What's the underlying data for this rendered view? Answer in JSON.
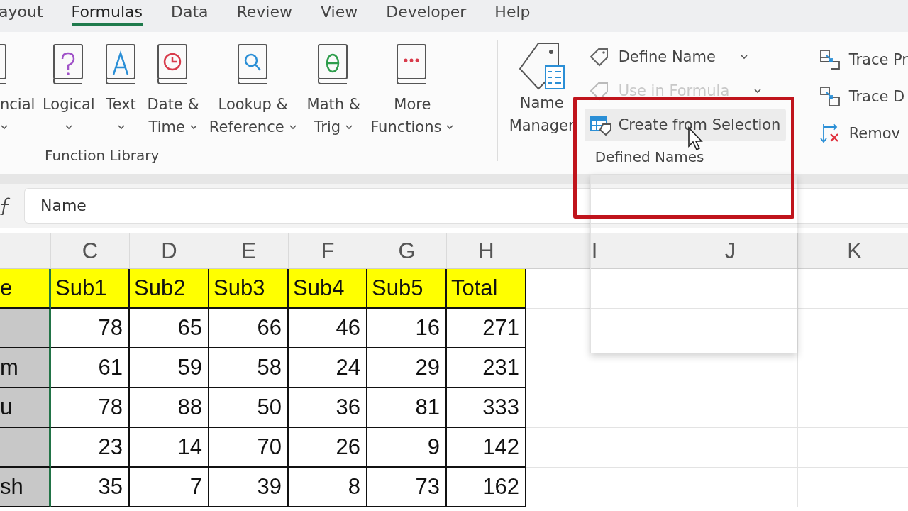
{
  "tabs": [
    {
      "label": "ayout",
      "selected": false
    },
    {
      "label": "Formulas",
      "selected": true
    },
    {
      "label": "Data",
      "selected": false
    },
    {
      "label": "Review",
      "selected": false
    },
    {
      "label": "View",
      "selected": false
    },
    {
      "label": "Developer",
      "selected": false
    },
    {
      "label": "Help",
      "selected": false
    }
  ],
  "function_library": {
    "label": "Function Library",
    "items": [
      {
        "kind": "financial",
        "lines": [
          "ncial"
        ],
        "dropdown": true
      },
      {
        "kind": "logical",
        "lines": [
          "Logical"
        ],
        "dropdown": true
      },
      {
        "kind": "text",
        "lines": [
          "Text"
        ],
        "dropdown": true
      },
      {
        "kind": "datetime",
        "lines": [
          "Date &",
          "Time"
        ],
        "dropdown": true
      },
      {
        "kind": "lookup",
        "lines": [
          "Lookup &",
          "Reference"
        ],
        "dropdown": true
      },
      {
        "kind": "math",
        "lines": [
          "Math &",
          "Trig"
        ],
        "dropdown": true
      },
      {
        "kind": "more",
        "lines": [
          "More",
          "Functions"
        ],
        "dropdown": true
      }
    ]
  },
  "defined_names": {
    "label": "Defined Names",
    "name_manager": [
      "Name",
      "Manager"
    ],
    "commands": [
      {
        "kind": "define",
        "label": "Define Name",
        "dropdown": true,
        "disabled": false,
        "hovered": false
      },
      {
        "kind": "use",
        "label": "Use in Formula",
        "dropdown": true,
        "disabled": true,
        "hovered": false
      },
      {
        "kind": "create",
        "label": "Create from Selection",
        "dropdown": false,
        "disabled": false,
        "hovered": true
      }
    ]
  },
  "formula_auditing": {
    "commands": [
      {
        "kind": "precedents",
        "label": "Trace Pr"
      },
      {
        "kind": "dependents",
        "label": "Trace D"
      },
      {
        "kind": "remove",
        "label": "Remov"
      }
    ]
  },
  "formula_bar": {
    "value": "Name"
  },
  "sheet": {
    "columns": [
      "",
      "C",
      "D",
      "E",
      "F",
      "G",
      "H",
      "I",
      "J",
      "K"
    ],
    "first_column_selected": true,
    "rows": [
      {
        "kind": "header",
        "cells": [
          "e",
          "Sub1",
          "Sub2",
          "Sub3",
          "Sub4",
          "Sub5",
          "Total"
        ]
      },
      {
        "kind": "data",
        "cells": [
          "",
          "78",
          "65",
          "66",
          "46",
          "16",
          "271"
        ]
      },
      {
        "kind": "data",
        "cells": [
          "m",
          "61",
          "59",
          "58",
          "24",
          "29",
          "231"
        ]
      },
      {
        "kind": "data",
        "cells": [
          "u",
          "78",
          "88",
          "50",
          "36",
          "81",
          "333"
        ]
      },
      {
        "kind": "data",
        "cells": [
          "",
          "23",
          "14",
          "70",
          "26",
          "9",
          "142"
        ]
      },
      {
        "kind": "data",
        "cells": [
          "sh",
          "35",
          "7",
          "39",
          "8",
          "73",
          "162"
        ]
      }
    ]
  }
}
